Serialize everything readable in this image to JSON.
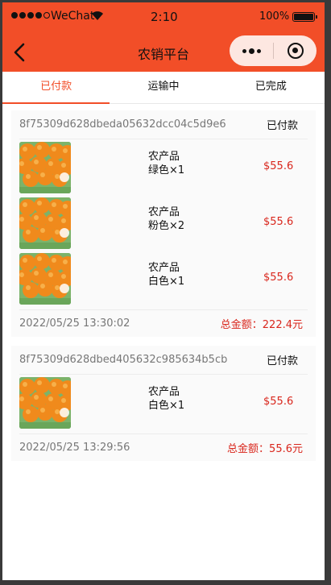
{
  "status_bar": {
    "carrier": "WeChat",
    "time": "2:10",
    "battery": "100%"
  },
  "nav": {
    "title": "农销平台"
  },
  "tabs": [
    {
      "label": "已付款",
      "active": true
    },
    {
      "label": "运输中",
      "active": false
    },
    {
      "label": "已完成",
      "active": false
    }
  ],
  "orders": [
    {
      "id": "8f75309d628dbeda05632dcc04c5d9e6",
      "status": "已付款",
      "items": [
        {
          "name": "农产品",
          "spec": "绿色×1",
          "price": "$55.6"
        },
        {
          "name": "农产品",
          "spec": "粉色×2",
          "price": "$55.6"
        },
        {
          "name": "农产品",
          "spec": "白色×1",
          "price": "$55.6"
        }
      ],
      "time": "2022/05/25 13:30:02",
      "total": "总金额：222.4元"
    },
    {
      "id": "8f75309d628dbed405632c985634b5cb",
      "status": "已付款",
      "items": [
        {
          "name": "农产品",
          "spec": "白色×1",
          "price": "$55.6"
        }
      ],
      "time": "2022/05/25 13:29:56",
      "total": "总金额：55.6元"
    }
  ],
  "colors": {
    "brand": "#f24e28",
    "price": "#d9261c"
  }
}
